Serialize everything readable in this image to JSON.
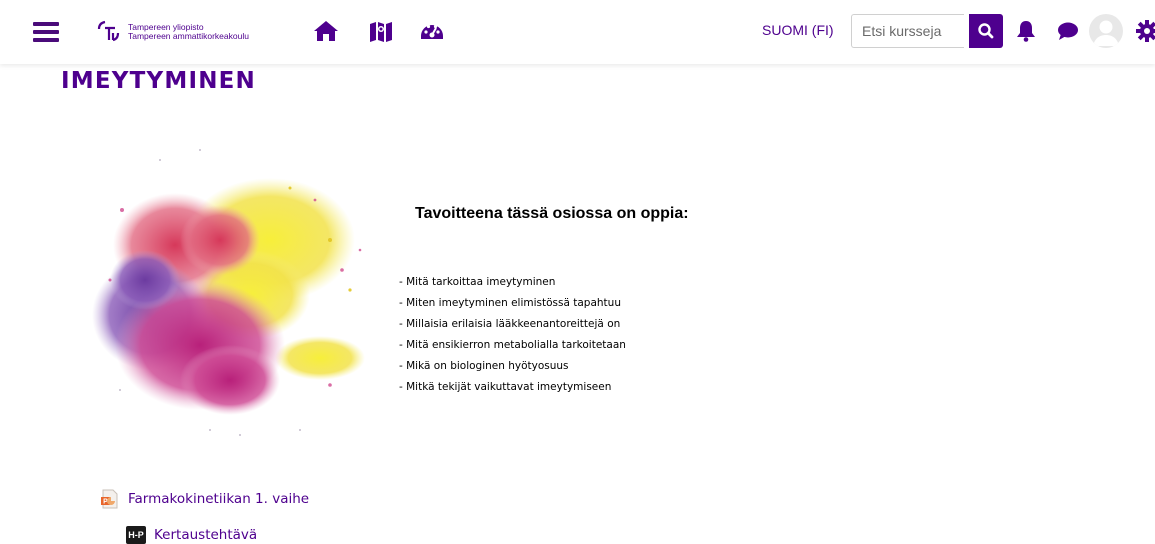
{
  "header": {
    "logo_line1": "Tampereen yliopisto",
    "logo_line2": "Tampereen ammattikorkeakoulu",
    "icons": [
      "menu-icon",
      "home-icon",
      "map-icon",
      "dashboard-icon",
      "search-icon",
      "bell-icon",
      "chat-icon",
      "avatar-icon",
      "gear-icon"
    ],
    "language": "SUOMI (FI)",
    "search_placeholder": "Etsi kursseja"
  },
  "colors": {
    "brand": "#4e008e",
    "text": "#000000"
  },
  "main": {
    "title": "IMEYTYMINEN",
    "goal_heading": "Tavoitteena tässä osiossa on oppia:",
    "goals": [
      "- Mitä tarkoittaa imeytyminen",
      "- Miten imeytyminen elimistössä tapahtuu",
      "- Millaisia erilaisia lääkkeenantoreittejä on",
      "- Mitä ensikierron metabolialla tarkoitetaan",
      "- Mikä on biologinen hyötyosuus",
      "- Mitkä tekijät vaikuttavat imeytymiseen"
    ]
  },
  "activities": [
    {
      "label": "Farmakokinetiikan 1. vaihe",
      "icon": "powerpoint-icon"
    },
    {
      "label": "Kertaustehtävä",
      "icon": "h5p-icon",
      "icon_text": "H-P"
    }
  ]
}
